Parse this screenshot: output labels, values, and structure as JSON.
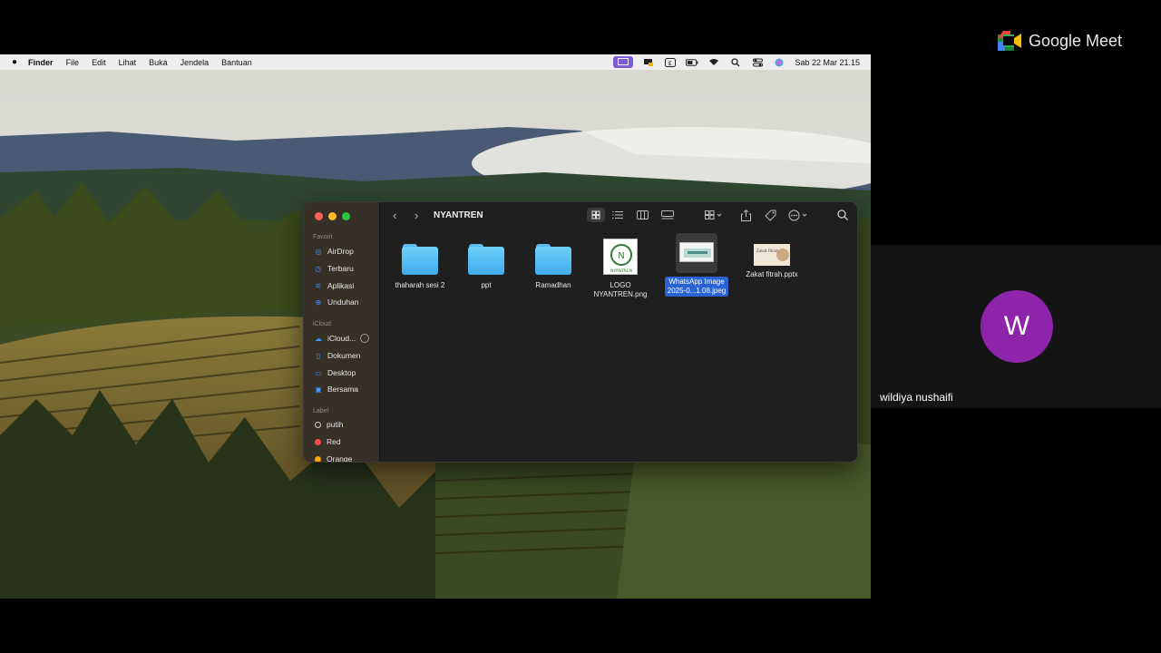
{
  "menubar": {
    "apple": "",
    "app_name": "Finder",
    "menus": [
      "File",
      "Edit",
      "Lihat",
      "Buka",
      "Jendela",
      "Bantuan"
    ],
    "clock": "Sab 22 Mar  21.15"
  },
  "finder": {
    "folder_title": "NYANTREN",
    "sidebar": {
      "favorites_header": "Favorit",
      "favorites": [
        "AirDrop",
        "Terbaru",
        "Aplikasi",
        "Unduhan"
      ],
      "icloud_header": "iCloud",
      "icloud": [
        "iCloud...",
        "Dokumen",
        "Desktop",
        "Bersama"
      ],
      "tags_header": "Label",
      "tags": [
        {
          "label": "putih",
          "color": "#ffffff"
        },
        {
          "label": "Red",
          "color": "#ff4d4d"
        },
        {
          "label": "Orange",
          "color": "#ffa500"
        }
      ]
    },
    "items": [
      {
        "name": "thaharah sesi 2",
        "kind": "folder"
      },
      {
        "name": "ppt",
        "kind": "folder"
      },
      {
        "name": "Ramadhan",
        "kind": "folder"
      },
      {
        "name_line1": "LOGO",
        "name_line2": "NYANTREN.png",
        "kind": "image",
        "thumb_text": "NYANTREN"
      },
      {
        "name_line1": "WhatsApp Image",
        "name_line2": "2025-0...1.08.jpeg",
        "kind": "image",
        "selected": true
      },
      {
        "name": "Zakat fitrah.pptx",
        "kind": "presentation",
        "thumb_text": "Zakat Fitrah"
      }
    ]
  },
  "meet": {
    "brand": "Google Meet",
    "participant_initial": "W",
    "participant_name": "wildiya nushaifi",
    "avatar_color": "#8e24aa"
  }
}
